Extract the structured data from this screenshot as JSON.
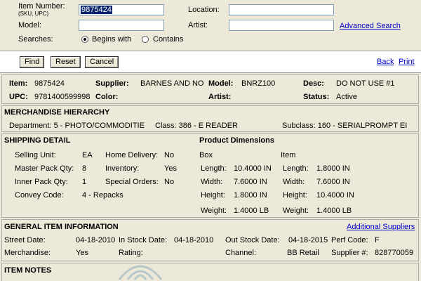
{
  "search": {
    "item_number_label": "Item Number:",
    "item_number_sub": "(SKU, UPC)",
    "item_number_value": "9875424",
    "location_label": "Location:",
    "model_label": "Model:",
    "artist_label": "Artist:",
    "searches_label": "Searches:",
    "begins_with": "Begins with",
    "contains": "Contains",
    "advanced_search": "Advanced Search"
  },
  "toolbar": {
    "find": "Find",
    "reset": "Reset",
    "cancel": "Cancel",
    "back": "Back",
    "print": "Print"
  },
  "item": {
    "item_label": "Item:",
    "item_value": "9875424",
    "supplier_label": "Supplier:",
    "supplier_value": "BARNES AND NO",
    "model_label": "Model:",
    "model_value": "BNRZ100",
    "desc_label": "Desc:",
    "desc_value": "DO NOT USE #1",
    "upc_label": "UPC:",
    "upc_value": "9781400599998",
    "color_label": "Color:",
    "artist_label": "Artist:",
    "status_label": "Status:",
    "status_value": "Active"
  },
  "hierarchy": {
    "title": "MERCHANDISE HIERARCHY",
    "department": "Department:  5 - PHOTO/COMMODITIE",
    "class": "Class:  386 - E READER",
    "subclass": "Subclass:  160 - SERIALPROMPT EI"
  },
  "shipping": {
    "title": "SHIPPING DETAIL",
    "selling_unit_label": "Selling Unit:",
    "selling_unit_value": "EA",
    "master_pack_label": "Master Pack Qty:",
    "master_pack_value": "8",
    "inner_pack_label": "Inner Pack Qty:",
    "inner_pack_value": "1",
    "convey_label": "Convey Code:",
    "convey_value": "4 - Repacks",
    "home_delivery_label": "Home Delivery:",
    "home_delivery_value": "No",
    "inventory_label": "Inventory:",
    "inventory_value": "Yes",
    "special_orders_label": "Special Orders:",
    "special_orders_value": "No"
  },
  "dimensions": {
    "title": "Product Dimensions",
    "box_label": "Box",
    "item_label": "Item",
    "length_label": "Length:",
    "width_label": "Width:",
    "height_label": "Height:",
    "weight_label": "Weight:",
    "box_length": "10.4000 IN",
    "box_width": "7.6000 IN",
    "box_height": "1.8000 IN",
    "box_weight": "1.4000 LB",
    "item_length": "1.8000 IN",
    "item_width": "7.6000 IN",
    "item_height": "10.4000 IN",
    "item_weight": "1.4000 LB"
  },
  "general": {
    "title": "GENERAL ITEM INFORMATION",
    "additional_suppliers": "Additional Suppliers",
    "street_date_label": "Street Date:",
    "street_date_value": "04-18-2010",
    "in_stock_label": "In Stock Date:",
    "in_stock_value": "04-18-2010",
    "out_stock_label": "Out Stock Date:",
    "out_stock_value": "04-18-2015",
    "perf_code_label": "Perf Code:",
    "perf_code_value": "F",
    "merchandise_label": "Merchandise:",
    "merchandise_value": "Yes",
    "rating_label": "Rating:",
    "channel_label": "Channel:",
    "channel_value": "BB Retail",
    "supplier_num_label": "Supplier #:",
    "supplier_num_value": "828770059"
  },
  "notes": {
    "title": "ITEM NOTES"
  },
  "colors": {
    "background": "#ece9d8",
    "link": "#0000cc",
    "selection": "#0a246a"
  }
}
